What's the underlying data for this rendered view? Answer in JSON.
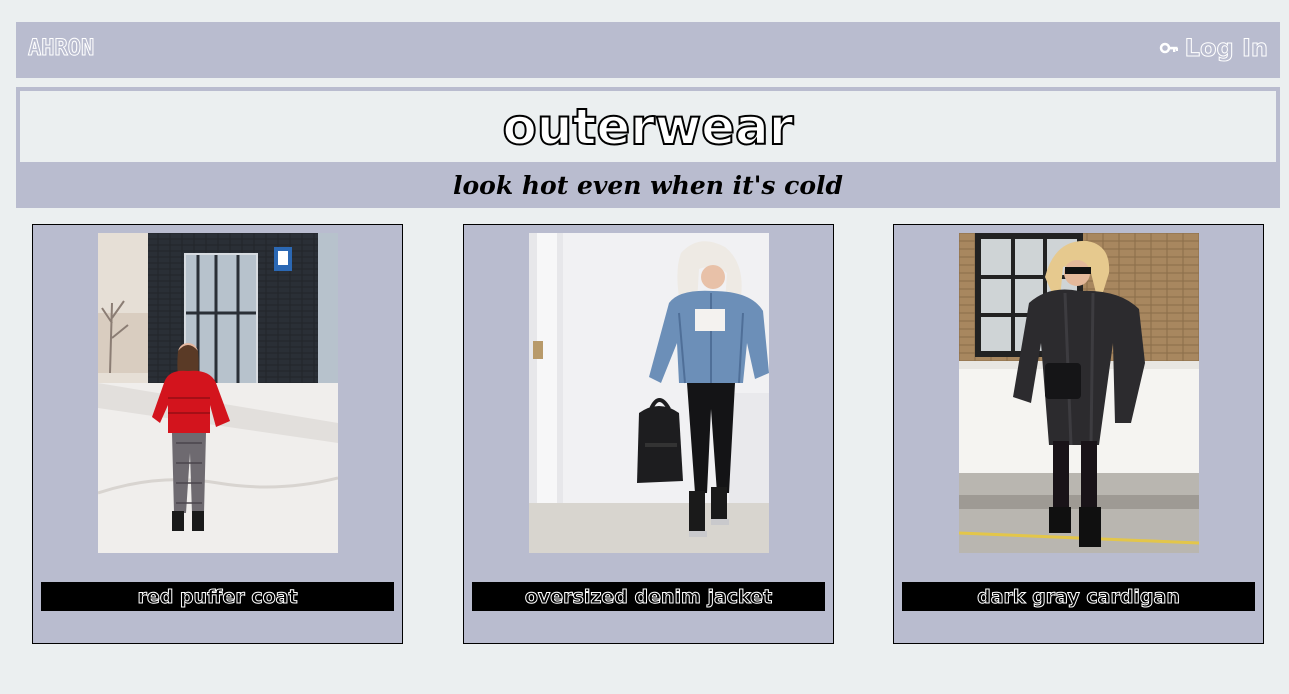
{
  "nav": {
    "brand": "AHRON",
    "login_label": "Log In",
    "login_icon": "key-icon"
  },
  "hero": {
    "title": "outerwear",
    "subtitle": "look hot even when it's cold"
  },
  "products": [
    {
      "label": "red puffer coat",
      "image": "woman-red-puffer-coat-photo"
    },
    {
      "label": "oversized denim jacket",
      "image": "woman-denim-jacket-photo"
    },
    {
      "label": "dark gray cardigan",
      "image": "woman-gray-cardigan-photo"
    }
  ],
  "colors": {
    "background": "#ebeff0",
    "panel": "#b9bccf",
    "label_bg": "#000000"
  }
}
